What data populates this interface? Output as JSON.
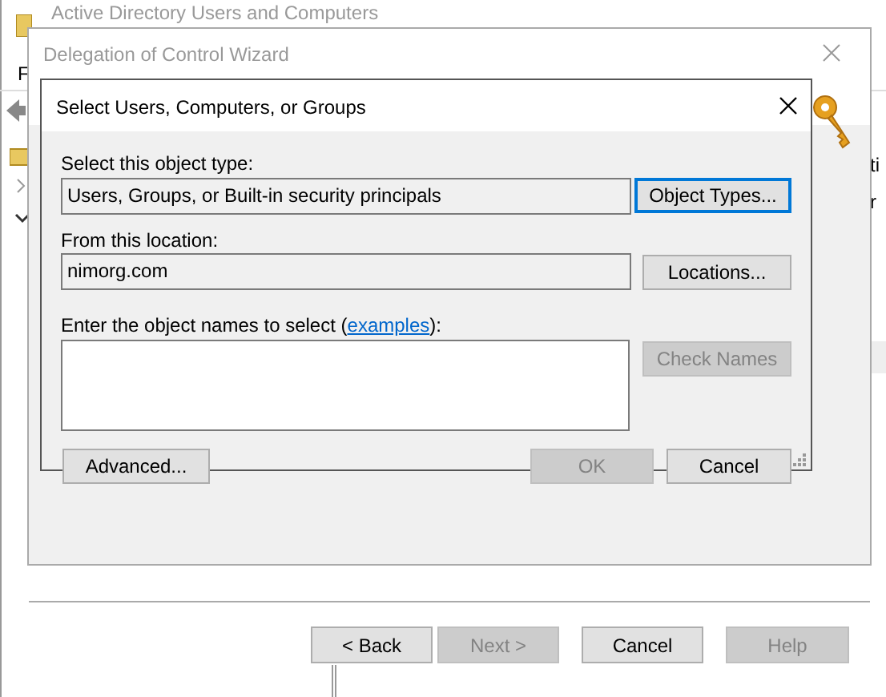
{
  "background_window": {
    "title": "Active Directory Users and Computers",
    "menu_item": "F",
    "column_text": "ti",
    "row_text": "r"
  },
  "wizard": {
    "title": "Delegation of Control Wizard",
    "buttons": [
      {
        "label": "< Back",
        "disabled": false
      },
      {
        "label": "Next >",
        "disabled": true
      },
      {
        "label": "Cancel",
        "disabled": false
      },
      {
        "label": "Help",
        "disabled": true
      }
    ]
  },
  "dialog": {
    "title": "Select Users, Computers, or Groups",
    "object_type_label": "Select this object type:",
    "object_type": "Users, Groups, or Built-in security principals",
    "object_types_button": {
      "label": "Object Types...",
      "focused": true,
      "disabled": false
    },
    "location_label": "From this location:",
    "location": "nimorg.com",
    "locations_button": {
      "label": "Locations...",
      "focused": false,
      "disabled": false
    },
    "names_label_before": "Enter the object names to select (",
    "names_link": "examples",
    "names_label_after": "):",
    "check_names_button": {
      "label": "Check Names",
      "disabled": true
    },
    "advanced_button": {
      "label": "Advanced...",
      "focused": false,
      "disabled": false
    },
    "ok_button": {
      "label": "OK",
      "disabled": true
    },
    "cancel_button": {
      "label": "Cancel",
      "focused": false,
      "disabled": false
    }
  }
}
